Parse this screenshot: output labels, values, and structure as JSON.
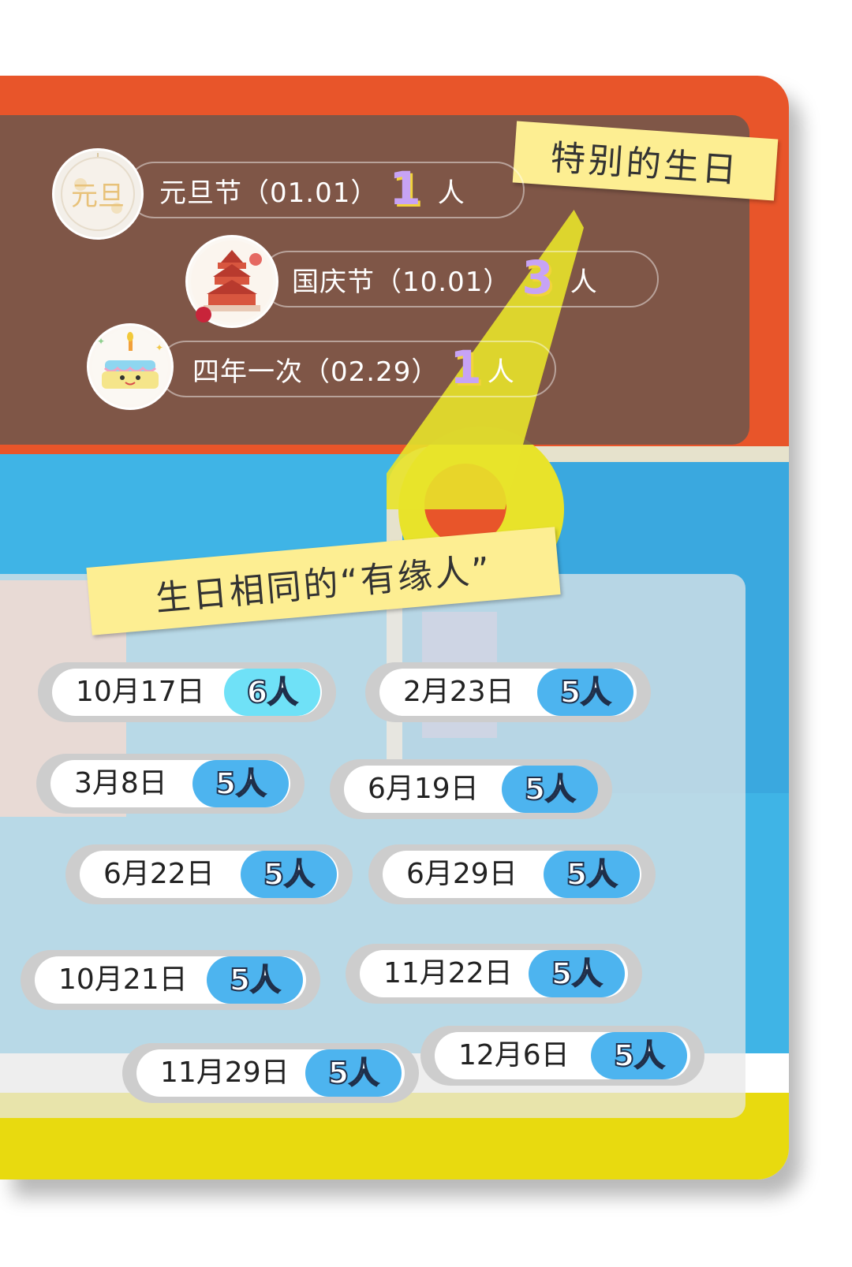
{
  "special": {
    "title": "特别的生日",
    "rows": [
      {
        "label": "元旦节（01.01）",
        "count": "1",
        "unit": "人"
      },
      {
        "label": "国庆节（10.01）",
        "count": "3",
        "unit": "人"
      },
      {
        "label": "四年一次（02.29）",
        "count": "1",
        "unit": "人"
      }
    ],
    "icons": [
      "yuandan-lantern-icon",
      "temple-of-heaven-icon",
      "birthday-cake-icon"
    ],
    "badge_text": "元旦"
  },
  "same": {
    "title": "生日相同的“有缘人”",
    "items": [
      {
        "date": "10月17日",
        "count": "6人"
      },
      {
        "date": "2月23日",
        "count": "5人"
      },
      {
        "date": "3月8日",
        "count": "5人"
      },
      {
        "date": "6月19日",
        "count": "5人"
      },
      {
        "date": "6月22日",
        "count": "5人"
      },
      {
        "date": "6月29日",
        "count": "5人"
      },
      {
        "date": "10月21日",
        "count": "5人"
      },
      {
        "date": "11月22日",
        "count": "5人"
      },
      {
        "date": "11月29日",
        "count": "5人"
      },
      {
        "date": "12月6日",
        "count": "5人"
      }
    ]
  },
  "colors": {
    "orange": "#e8552a",
    "blue": "#3fb4e6",
    "yellow": "#e8da0f",
    "count_blue": "#4db4ef",
    "count_highlight": "#6fe1f7",
    "tag_yellow": "#fdee92",
    "number_purple": "#c7a3f5"
  }
}
